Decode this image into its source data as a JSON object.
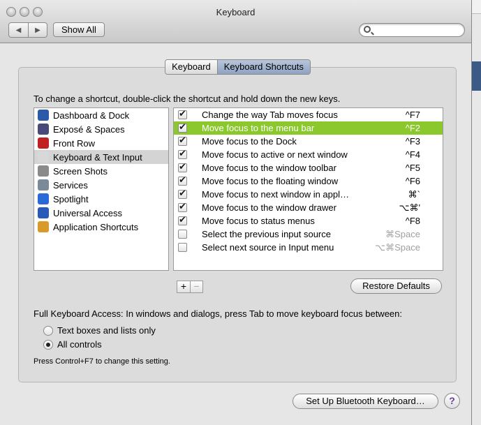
{
  "window": {
    "title": "Keyboard",
    "show_all": "Show All"
  },
  "tabs": [
    {
      "label": "Keyboard"
    },
    {
      "label": "Keyboard Shortcuts"
    }
  ],
  "instruction": "To change a shortcut, double-click the shortcut and hold down the new keys.",
  "categories": [
    {
      "label": "Dashboard & Dock",
      "icon": "dashboard-dock-icon",
      "color": "#2a5aa8"
    },
    {
      "label": "Exposé & Spaces",
      "icon": "expose-spaces-icon",
      "color": "#4a4a7a"
    },
    {
      "label": "Front Row",
      "icon": "front-row-icon",
      "color": "#c02020"
    },
    {
      "label": "Keyboard & Text Input",
      "icon": "keyboard-icon",
      "color": "#d8d8d8",
      "selected": true
    },
    {
      "label": "Screen Shots",
      "icon": "screen-shots-icon",
      "color": "#8a8a8a"
    },
    {
      "label": "Services",
      "icon": "services-icon",
      "color": "#7a8a9a"
    },
    {
      "label": "Spotlight",
      "icon": "spotlight-icon",
      "color": "#2a6ad8"
    },
    {
      "label": "Universal Access",
      "icon": "universal-access-icon",
      "color": "#2a5ab8"
    },
    {
      "label": "Application Shortcuts",
      "icon": "application-shortcuts-icon",
      "color": "#d89a2a"
    }
  ],
  "shortcuts": [
    {
      "checked": true,
      "label": "Change the way Tab moves focus",
      "key": "^F7"
    },
    {
      "checked": true,
      "label": "Move focus to the menu bar",
      "key": "^F2",
      "highlighted": true
    },
    {
      "checked": true,
      "label": "Move focus to the Dock",
      "key": "^F3"
    },
    {
      "checked": true,
      "label": "Move focus to active or next window",
      "key": "^F4"
    },
    {
      "checked": true,
      "label": "Move focus to the window toolbar",
      "key": "^F5"
    },
    {
      "checked": true,
      "label": "Move focus to the floating window",
      "key": "^F6"
    },
    {
      "checked": true,
      "label": "Move focus to next window in appl…",
      "key": "⌘`"
    },
    {
      "checked": true,
      "label": "Move focus to the window drawer",
      "key": "⌥⌘'"
    },
    {
      "checked": true,
      "label": "Move focus to status menus",
      "key": "^F8"
    },
    {
      "checked": false,
      "label": "Select the previous input source",
      "key": "⌘Space"
    },
    {
      "checked": false,
      "label": "Select next source in Input menu",
      "key": "⌥⌘Space"
    }
  ],
  "buttons": {
    "plus": "+",
    "minus": "−",
    "restore": "Restore Defaults",
    "bluetooth": "Set Up Bluetooth Keyboard…",
    "help": "?"
  },
  "full_keyboard_access": {
    "label": "Full Keyboard Access: In windows and dialogs, press Tab to move keyboard focus between:",
    "options": [
      {
        "label": "Text boxes and lists only",
        "selected": false
      },
      {
        "label": "All controls",
        "selected": true
      }
    ],
    "hint": "Press Control+F7 to change this setting."
  },
  "colors": {
    "highlight": "#8ac82d",
    "selected_row": "#d4d4d4"
  }
}
